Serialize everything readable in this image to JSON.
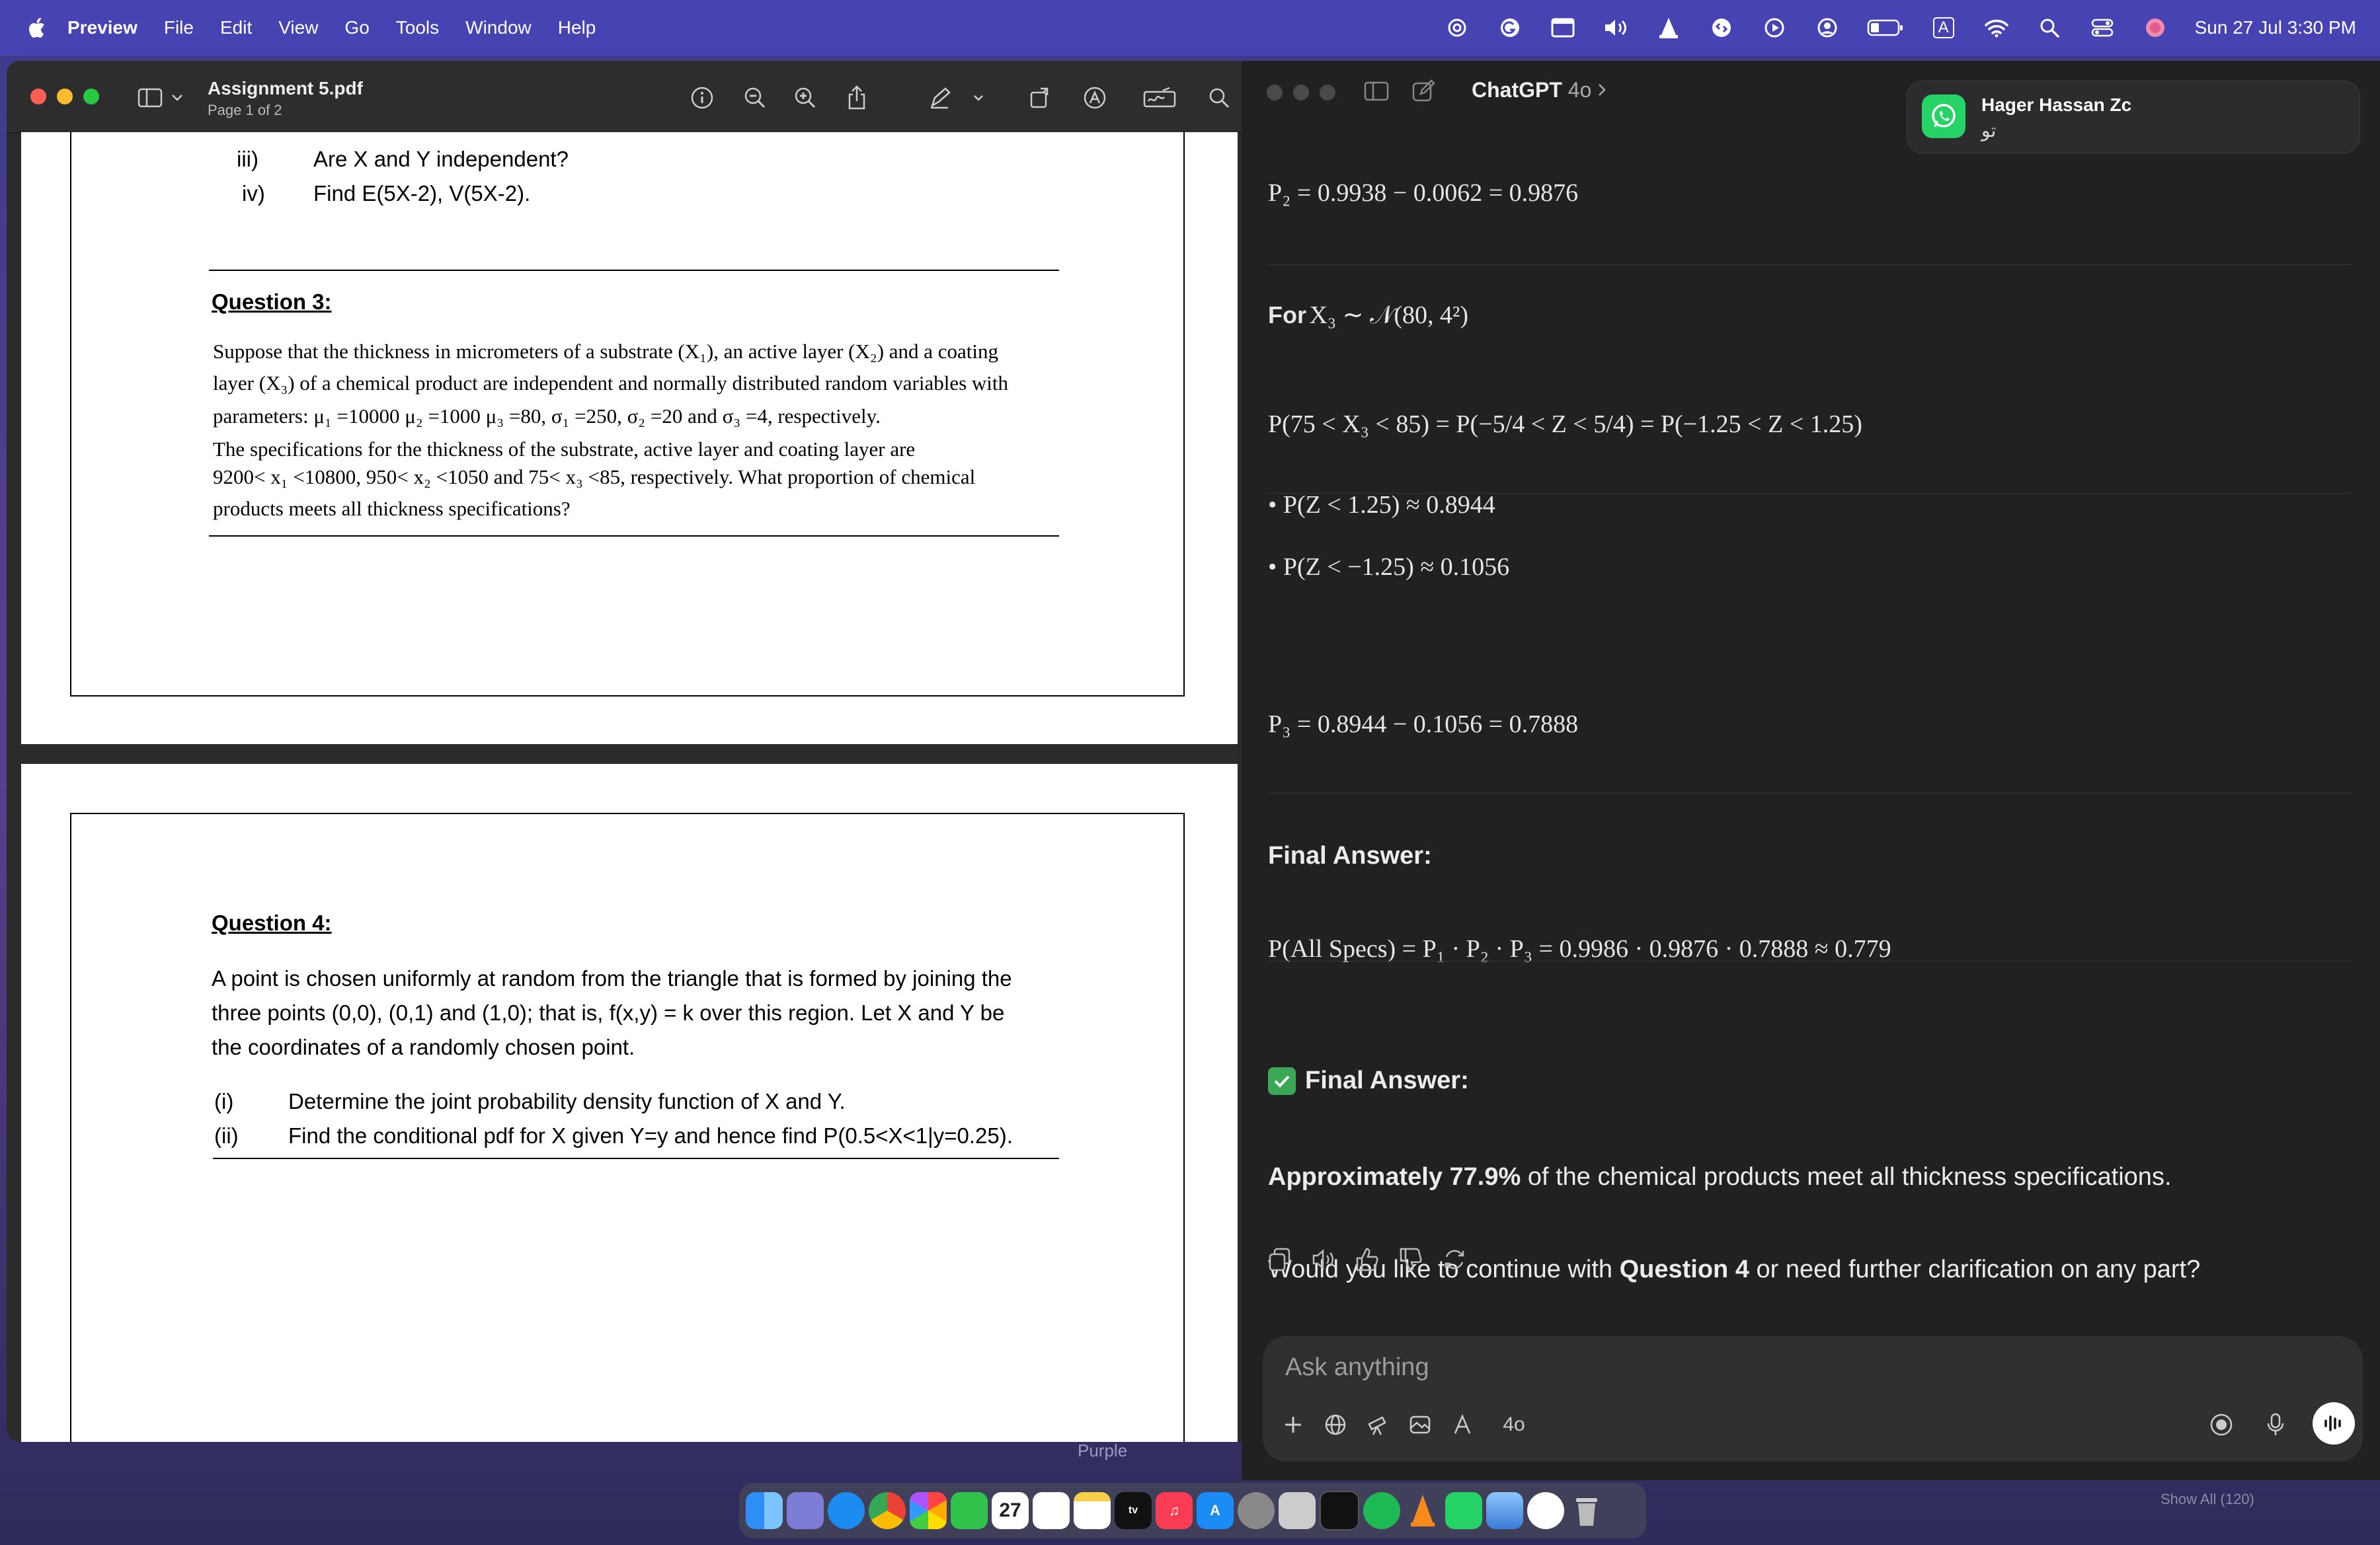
{
  "menubar": {
    "app": "Preview",
    "items": [
      "File",
      "Edit",
      "View",
      "Go",
      "Tools",
      "Window",
      "Help"
    ],
    "clock": "Sun 27 Jul  3:30 PM",
    "input_source": "A"
  },
  "preview": {
    "title": "Assignment 5.pdf",
    "subtitle": "Page 1 of 2",
    "page1": {
      "items": [
        {
          "num": "iii)",
          "text": "Are X and Y independent?"
        },
        {
          "num": "iv)",
          "text": "Find  E(5X-2), V(5X-2)."
        }
      ],
      "q3_heading": "Question 3:",
      "q3_lines": [
        "Suppose that the thickness in micrometers of a substrate (X₁), an active layer (X₂) and a coating",
        "layer (X₃) of a chemical product are independent and normally distributed random variables with",
        "parameters:  μ₁ =10000   μ₂ =1000   μ₃ =80,   σ₁ =250,   σ₂ =20  and  σ₃ =4,  respectively.",
        "The specifications for the thickness of the substrate, active layer and coating layer are",
        "9200< x₁ <10800, 950< x₂ <1050  and  75< x₃ <85, respectively. What proportion of chemical",
        "products meets all thickness specifications?"
      ]
    },
    "page2": {
      "q4_heading": "Question 4:",
      "q4_lines": [
        "A point is chosen uniformly at random from the triangle that is formed by joining the",
        "three points (0,0), (0,1) and (1,0); that is, f(x,y) = k over this region. Let X and Y be",
        "the coordinates of a randomly chosen point."
      ],
      "q4_items": [
        {
          "num": "(i)",
          "text": "Determine the joint probability density function of X and Y."
        },
        {
          "num": "(ii)",
          "text": "Find the conditional pdf for X given Y=y and hence find P(0.5<X<1|y=0.25)."
        }
      ]
    }
  },
  "chat": {
    "title": "ChatGPT",
    "model": "4o",
    "lines": {
      "p2": "P₂ = 0.9938 − 0.0062 = 0.9876",
      "for_label": "For",
      "for_math": "X₃ ∼ 𝒩(80, 4²)",
      "p3_interval": "P(75 < X₃ < 85) = P(−5/4 < Z < 5/4) = P(−1.25 < Z < 1.25)",
      "bullet1": "P(Z < 1.25) ≈ 0.8944",
      "bullet2": "P(Z < −1.25) ≈ 0.1056",
      "p3": "P₃ = 0.8944 − 0.1056 = 0.7888",
      "final_heading": "Final Answer:",
      "all_specs": "P(All Specs) = P₁ · P₂ · P₃ = 0.9986 · 0.9876 · 0.7888 ≈ 0.779",
      "final_heading2": "Final Answer:",
      "answer_bold": "Approximately 77.9%",
      "answer_rest": " of the chemical products meet all thickness specifications.",
      "q_pre": "Would you like to continue with ",
      "q_bold": "Question 4",
      "q_post": " or need further clarification on any part?"
    },
    "composer": {
      "placeholder": "Ask anything",
      "model_label": "4o"
    }
  },
  "notification": {
    "name": "Hager Hassan Zc",
    "message": "تو"
  },
  "background": {
    "label": "Purple",
    "show_all": "Show All (120)"
  },
  "dock": {
    "calendar_day": "27"
  }
}
